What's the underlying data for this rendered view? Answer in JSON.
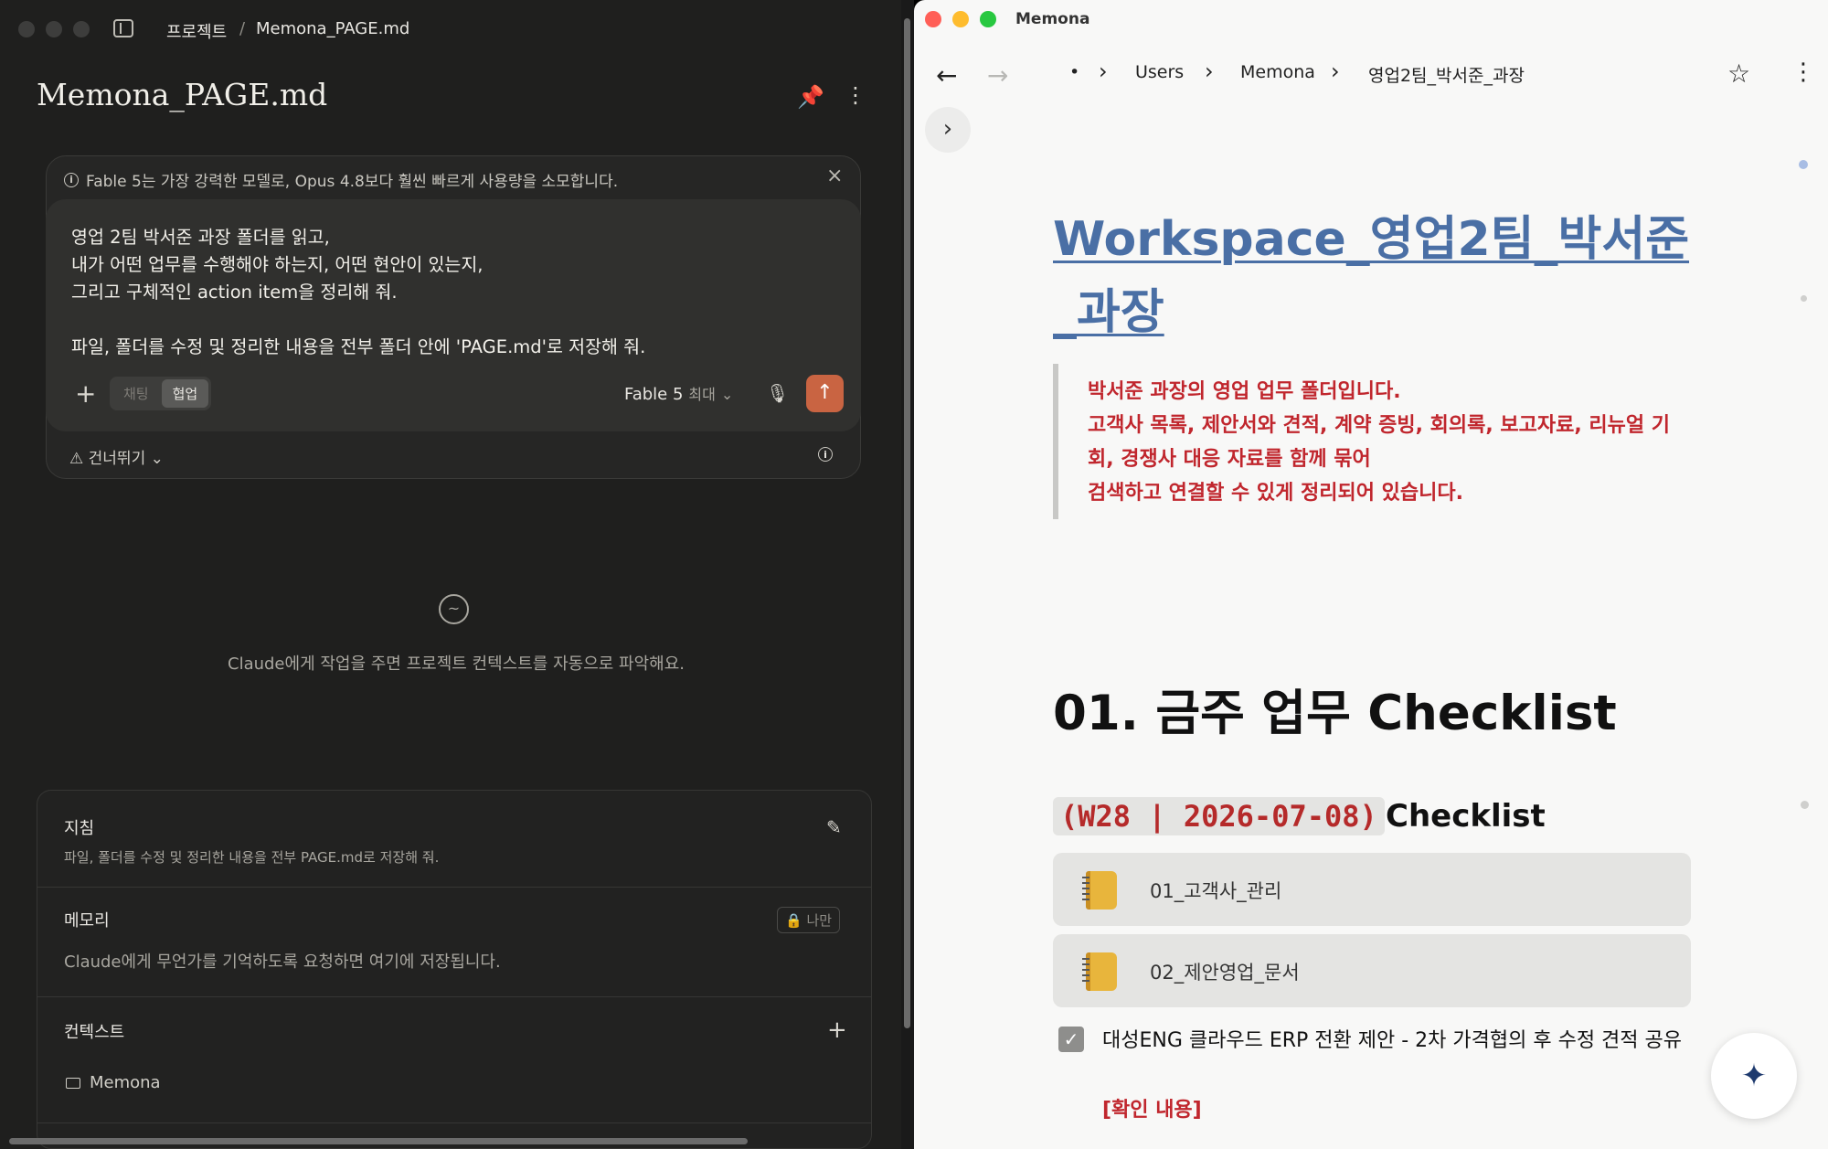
{
  "left_window": {
    "breadcrumb": [
      "프로젝트",
      "Memona_PAGE.md"
    ],
    "breadcrumb_sep": "/",
    "title": "Memona_PAGE.md",
    "notice": "Fable 5는 가장 강력한 모델로, Opus 4.8보다 훨씬 빠르게 사용량을 소모합니다.",
    "prompt_text": "영업 2팀 박서준 과장 폴더를 읽고,\n내가 어떤 업무를 수행해야 하는지, 어떤 현안이 있는지,\n그리고 구체적인 action item을 정리해 줘.\n\n파일, 폴더를 수정 및 정리한 내용을 전부 폴더 안에 'PAGE.md'로 저장해 줘.",
    "mode_options": [
      "채팅",
      "협업"
    ],
    "mode_selected": "협업",
    "model_name": "Fable 5",
    "model_effort": "최대",
    "skip_label": "건너뛰기",
    "empty_state_text": "Claude에게 작업을 주면 프로젝트 컨텍스트를 자동으로 파악해요.",
    "instructions": {
      "title": "지침",
      "text": "파일, 폴더를 수정 및 정리한 내용을 전부 PAGE.md로 저장해 줘."
    },
    "memory": {
      "title": "메모리",
      "badge": "나만",
      "text": "Claude에게 무언가를 기억하도록 요청하면 여기에 저장됩니다."
    },
    "context": {
      "title": "컨텍스트",
      "folder": "Memona"
    }
  },
  "right_window": {
    "app_name": "Memona",
    "path": [
      "•",
      "Users",
      "Memona",
      "영업2팀_박서준_과장"
    ],
    "page_title": "Workspace_영업2팀_박서준_과장",
    "quote_lines": [
      "박서준 과장의 영업 업무 폴더입니다.",
      "고객사 목록, 제안서와 견적, 계약 증빙, 회의록, 보고자료, 리뉴얼 기회, 경쟁사 대응 자료를 함께 묶어",
      "검색하고 연결할 수 있게 정리되어 있습니다."
    ],
    "section_heading": "01. 금주 업무 Checklist",
    "week_code": "(W28 | 2026-07-08)",
    "week_suffix": "Checklist",
    "folders": [
      "01_고객사_관리",
      "02_제안영업_문서"
    ],
    "task": {
      "checked": true,
      "text": "대성ENG 클라우드 ERP 전환 제안 - 2차 가격협의 후 수정 견적 공유",
      "note": "[확인 내용]"
    }
  },
  "colors": {
    "accent_send": "#c96442",
    "title_link": "#4a6fa5",
    "quote_red": "#c0262d"
  }
}
